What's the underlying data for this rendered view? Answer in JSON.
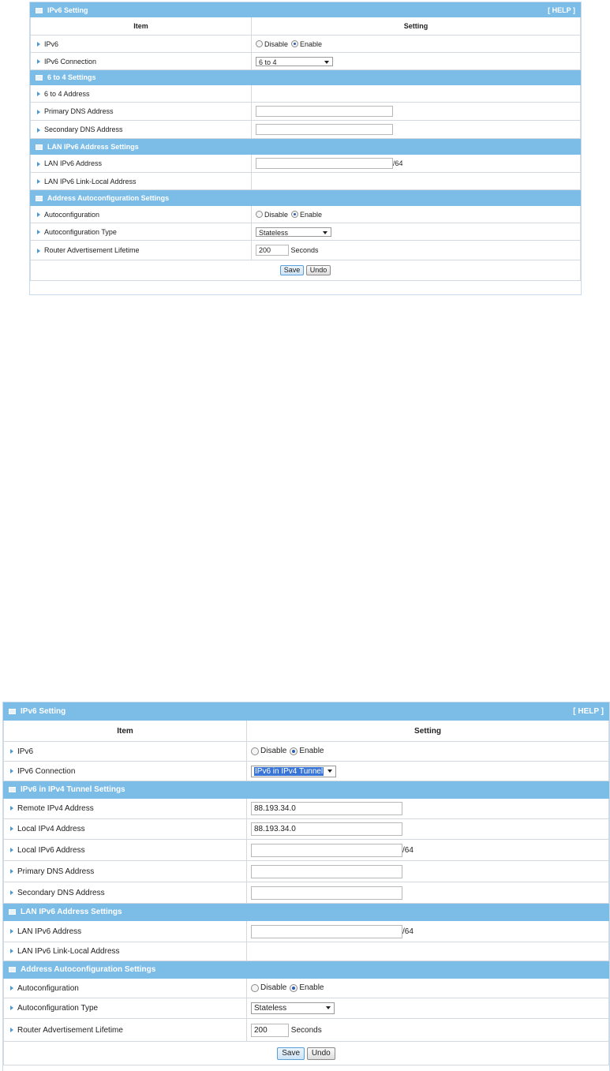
{
  "p1": {
    "title": "IPv6 Setting",
    "help": "[ HELP ]",
    "col_item": "Item",
    "col_setting": "Setting",
    "ipv6_label": "IPv6",
    "disable": "Disable",
    "enable": "Enable",
    "conn_label": "IPv6 Connection",
    "conn_value": "6 to 4",
    "sect1": "6 to 4 Settings",
    "addr_6to4": "6 to 4 Address",
    "primary_dns": "Primary DNS Address",
    "secondary_dns": "Secondary DNS Address",
    "sect2": "LAN IPv6 Address Settings",
    "lan_ipv6": "LAN IPv6 Address",
    "suffix_64": "/64",
    "lan_link_local": "LAN IPv6 Link-Local Address",
    "sect3": "Address Autoconfiguration Settings",
    "autoconf": "Autoconfiguration",
    "autoconf_type": "Autoconfiguration Type",
    "autoconf_type_value": "Stateless",
    "ra_lifetime": "Router Advertisement Lifetime",
    "ra_value": "200",
    "seconds": "Seconds",
    "save": "Save",
    "undo": "Undo"
  },
  "p2": {
    "title": "IPv6 Setting",
    "help": "[ HELP ]",
    "col_item": "Item",
    "col_setting": "Setting",
    "ipv6_label": "IPv6",
    "disable": "Disable",
    "enable": "Enable",
    "conn_label": "IPv6 Connection",
    "conn_value": "IPv6 in IPv4 Tunnel",
    "sect1": "IPv6 in IPv4 Tunnel Settings",
    "remote_ipv4": "Remote IPv4 Address",
    "remote_ipv4_value": "88.193.34.0",
    "local_ipv4": "Local IPv4 Address",
    "local_ipv4_value": "88.193.34.0",
    "local_ipv6": "Local IPv6 Address",
    "suffix_64": "/64",
    "primary_dns": "Primary DNS Address",
    "secondary_dns": "Secondary DNS Address",
    "sect2": "LAN IPv6 Address Settings",
    "lan_ipv6": "LAN IPv6 Address",
    "lan_link_local": "LAN IPv6 Link-Local Address",
    "sect3": "Address Autoconfiguration Settings",
    "autoconf": "Autoconfiguration",
    "autoconf_type": "Autoconfiguration Type",
    "autoconf_type_value": "Stateless",
    "ra_lifetime": "Router Advertisement Lifetime",
    "ra_value": "200",
    "seconds": "Seconds",
    "save": "Save",
    "undo": "Undo"
  },
  "colors": {
    "header_blue": "#7cbde8",
    "row_border": "#d3d9df",
    "radio_selected": "#2a5db0"
  }
}
